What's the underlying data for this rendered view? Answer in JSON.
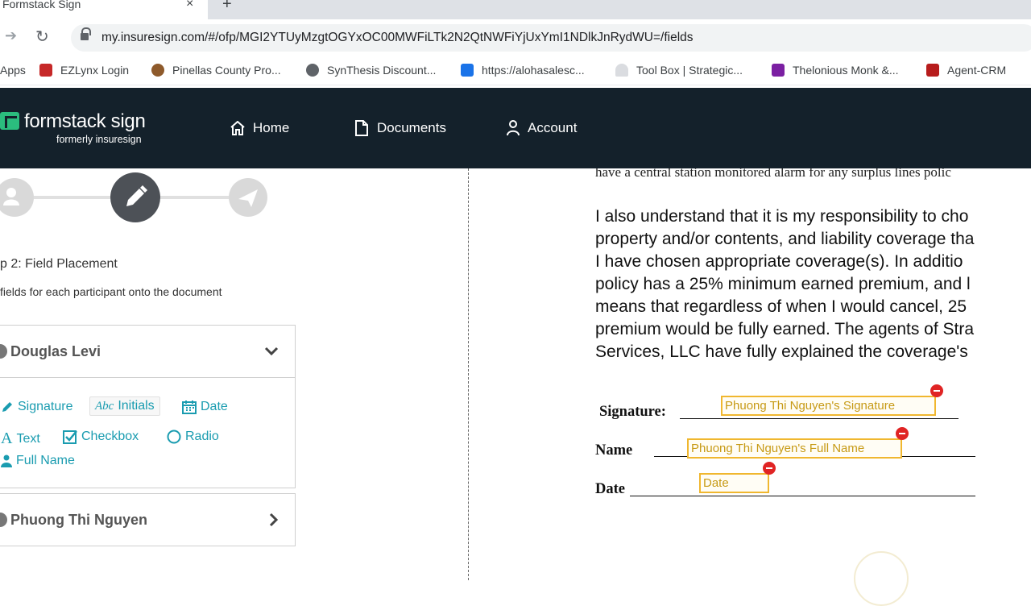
{
  "browser": {
    "tab_title": "Formstack Sign",
    "close": "×",
    "new_tab": "+",
    "url": "my.insuresign.com/#/ofp/MGI2YTUyMzgtOGYxOC00MWFiLTk2N2QtNWFiYjUxYmI1NDlkJnRydWU=/fields",
    "bookmarks": [
      {
        "label": "Apps",
        "color": "#4285f4"
      },
      {
        "label": "EZLynx Login",
        "color": "#c62828"
      },
      {
        "label": "Pinellas County Pro...",
        "color": "#8e5a2b"
      },
      {
        "label": "SynThesis Discount...",
        "color": "#5f6368"
      },
      {
        "label": "https://alohasalesc...",
        "color": "#1a73e8"
      },
      {
        "label": "Tool Box | Strategic...",
        "color": "#dadce0"
      },
      {
        "label": "Thelonious Monk &...",
        "color": "#7b1fa2"
      },
      {
        "label": "Agent-CRM",
        "color": "#b71c1c"
      }
    ]
  },
  "header": {
    "logo": "formstack sign",
    "logo_sub": "formerly insuresign",
    "nav": {
      "home": "Home",
      "documents": "Documents",
      "account": "Account"
    }
  },
  "panel": {
    "step_title": "p 2: Field Placement",
    "step_desc": " fields for each participant onto the document",
    "participants": [
      {
        "name": "Douglas Levi",
        "fields": {
          "signature": "Signature",
          "initials": "Initials",
          "initials_glyph": "Abc",
          "date": "Date",
          "text": "Text",
          "text_glyph": "A",
          "checkbox": "Checkbox",
          "radio": "Radio",
          "full_name": "Full Name"
        }
      },
      {
        "name": "Phuong Thi Nguyen"
      }
    ]
  },
  "document": {
    "cut_line": "have a central station monitored alarm for any surplus lines polic",
    "paragraph": [
      "I also understand that it is my responsibility to cho",
      "property and/or contents, and liability coverage tha",
      "I have chosen appropriate coverage(s).  In additio",
      "policy has a 25% minimum earned premium, and l",
      "means that regardless of when I would cancel, 25",
      "premium would be fully earned. The agents of Stra",
      "Services, LLC have fully explained the coverage's"
    ],
    "labels": {
      "signature": "Signature:",
      "name": "Name",
      "date": "Date"
    },
    "placed_fields": {
      "signature": "Phuong Thi Nguyen's Signature",
      "full_name": "Phuong Thi Nguyen's Full Name",
      "date": "Date"
    }
  },
  "colors": {
    "header_bg": "#14212b",
    "accent_teal": "#1a9cb0",
    "field_border": "#f0b72f",
    "remove_red": "#e02424"
  }
}
